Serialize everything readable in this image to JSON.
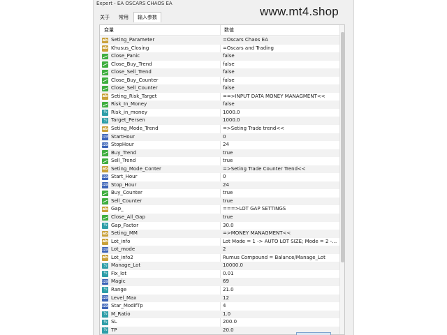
{
  "window": {
    "title": "Expert - EA OSCARS CHAOS EA",
    "tabs": [
      {
        "label": "关于"
      },
      {
        "label": "常用"
      },
      {
        "label": "输入参数",
        "active": true
      }
    ]
  },
  "table": {
    "col_variable": "变量",
    "col_value": "数值",
    "rows": [
      {
        "name": "Seting_Parameter",
        "value": "=Oscars Chaos EA",
        "type": "str-icon"
      },
      {
        "name": "Khusus_Closing",
        "value": "=Oscars and Trading",
        "type": "str-icon"
      },
      {
        "name": "Close_Panic",
        "value": "false",
        "type": "bool-icon"
      },
      {
        "name": "Close_Buy_Trend",
        "value": "false",
        "type": "bool-icon"
      },
      {
        "name": "Close_Sell_Trend",
        "value": "false",
        "type": "bool-icon"
      },
      {
        "name": "Close_Buy_Counter",
        "value": "false",
        "type": "bool-icon"
      },
      {
        "name": "Close_Sell_Counter",
        "value": "false",
        "type": "bool-icon"
      },
      {
        "name": "Seting_Risk_Target",
        "value": "==>INPUT DATA MONEY MANAGMENT<<",
        "type": "str-icon"
      },
      {
        "name": "Risk_In_Money",
        "value": "false",
        "type": "bool-icon"
      },
      {
        "name": "Risk_in_money",
        "value": "1000.0",
        "type": "dbl-icon"
      },
      {
        "name": "Target_Persen",
        "value": "1000.0",
        "type": "dbl-icon"
      },
      {
        "name": "Seting_Mode_Trend",
        "value": "=>Seting Trade trend<<",
        "type": "str-icon"
      },
      {
        "name": "StartHour",
        "value": "0",
        "type": "int-icon"
      },
      {
        "name": "StopHour",
        "value": "24",
        "type": "int-icon"
      },
      {
        "name": "Buy_Trend",
        "value": "true",
        "type": "bool-icon"
      },
      {
        "name": "Sell_Trend",
        "value": "true",
        "type": "bool-icon"
      },
      {
        "name": "Seting_Mode_Conter",
        "value": "=>Seting Trade Counter Trend<<",
        "type": "str-icon"
      },
      {
        "name": "Start_Hour",
        "value": "0",
        "type": "int-icon"
      },
      {
        "name": "Stop_Hour",
        "value": "24",
        "type": "int-icon"
      },
      {
        "name": "Buy_Counter",
        "value": "true",
        "type": "bool-icon"
      },
      {
        "name": "Sell_Counter",
        "value": "true",
        "type": "bool-icon"
      },
      {
        "name": "Gap_",
        "value": "===>LOT GAP SETTINGS",
        "type": "str-icon"
      },
      {
        "name": "Close_All_Gap",
        "value": "true",
        "type": "bool-icon"
      },
      {
        "name": "Gap_Factor",
        "value": "30.0",
        "type": "dbl-icon"
      },
      {
        "name": "Seting_MM",
        "value": "=>MONEY MANAGMENT<<",
        "type": "str-icon"
      },
      {
        "name": "Lot_info",
        "value": "Lot Mode = 1 -> AUTO LOT SIZE; Mode = 2 -> FIX...",
        "type": "str-icon"
      },
      {
        "name": "Lot_mode",
        "value": "2",
        "type": "int-icon"
      },
      {
        "name": "Lot_info2",
        "value": "Rumus Compound = Balance/Manage_Lot",
        "type": "str-icon"
      },
      {
        "name": "Manage_Lot",
        "value": "10000.0",
        "type": "dbl-icon"
      },
      {
        "name": "Fix_lot",
        "value": "0.01",
        "type": "dbl-icon"
      },
      {
        "name": "Magic",
        "value": "69",
        "type": "int-icon"
      },
      {
        "name": "Range",
        "value": "21.0",
        "type": "dbl-icon"
      },
      {
        "name": "Level_Max",
        "value": "12",
        "type": "int-icon"
      },
      {
        "name": "Star_ModifTp",
        "value": "4",
        "type": "int-icon"
      },
      {
        "name": "M_Ratio",
        "value": "1.0",
        "type": "dbl-icon"
      },
      {
        "name": "SL",
        "value": "200.0",
        "type": "dbl-icon"
      },
      {
        "name": "TP",
        "value": "20.0",
        "type": "dbl-icon"
      }
    ]
  },
  "watermark": "www.mt4.shop"
}
